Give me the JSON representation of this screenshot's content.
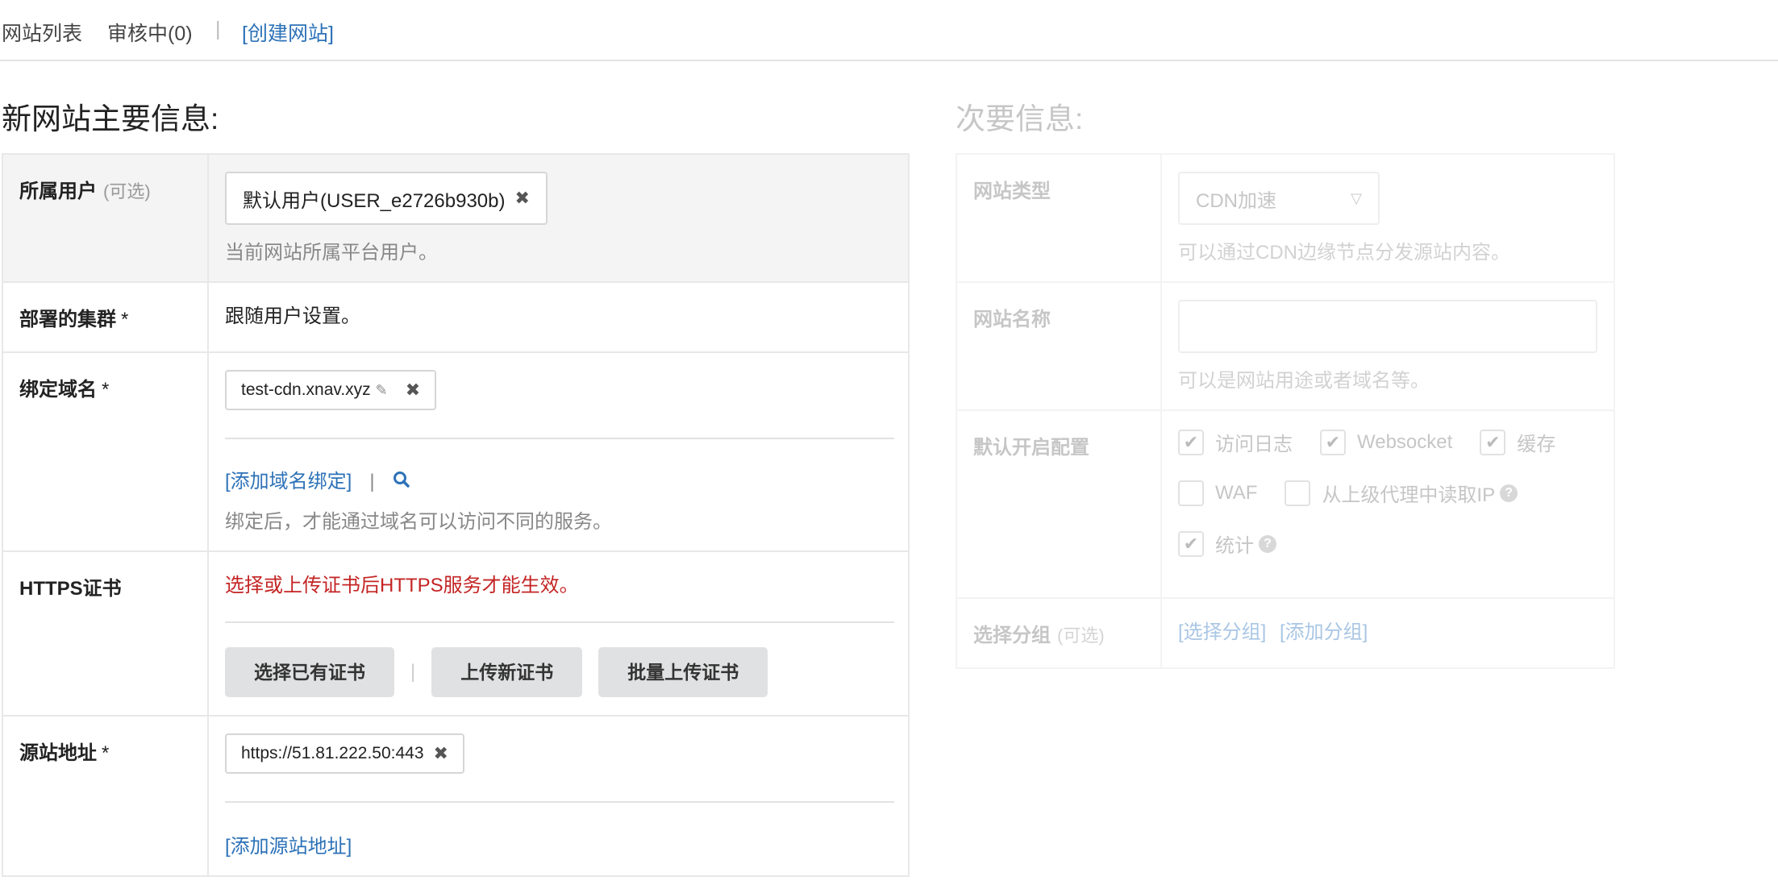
{
  "top_tabs": {
    "site_list": "网站列表",
    "reviewing": "审核中(0)",
    "separator": "|",
    "create_site": "[创建网站]"
  },
  "main": {
    "heading": "新网站主要信息:",
    "user": {
      "label": "所属用户",
      "optional": "(可选)",
      "value": "默认用户(USER_e2726b930b)",
      "help": "当前网站所属平台用户。"
    },
    "cluster": {
      "label": "部署的集群",
      "required": "*",
      "value": "跟随用户设置。"
    },
    "domain": {
      "label": "绑定域名",
      "required": "*",
      "value": "test-cdn.xnav.xyz",
      "add_link": "[添加域名绑定]",
      "separator": "|",
      "help": "绑定后，才能通过域名可以访问不同的服务。"
    },
    "https": {
      "label": "HTTPS证书",
      "warning": "选择或上传证书后HTTPS服务才能生效。",
      "btn_select": "选择已有证书",
      "separator": "|",
      "btn_upload": "上传新证书",
      "btn_batch": "批量上传证书"
    },
    "origin": {
      "label": "源站地址",
      "required": "*",
      "value": "https://51.81.222.50:443",
      "add_link": "[添加源站地址]"
    }
  },
  "secondary": {
    "heading": "次要信息:",
    "site_type": {
      "label": "网站类型",
      "value": "CDN加速",
      "help": "可以通过CDN边缘节点分发源站内容。"
    },
    "site_name": {
      "label": "网站名称",
      "help": "可以是网站用途或者域名等。"
    },
    "defaults": {
      "label": "默认开启配置",
      "access_log": "访问日志",
      "websocket": "Websocket",
      "cache": "缓存",
      "waf": "WAF",
      "read_ip": "从上级代理中读取IP",
      "stats": "统计"
    },
    "group": {
      "label": "选择分组",
      "optional": "(可选)",
      "select_link": "[选择分组]",
      "add_link": "[添加分组]"
    }
  }
}
